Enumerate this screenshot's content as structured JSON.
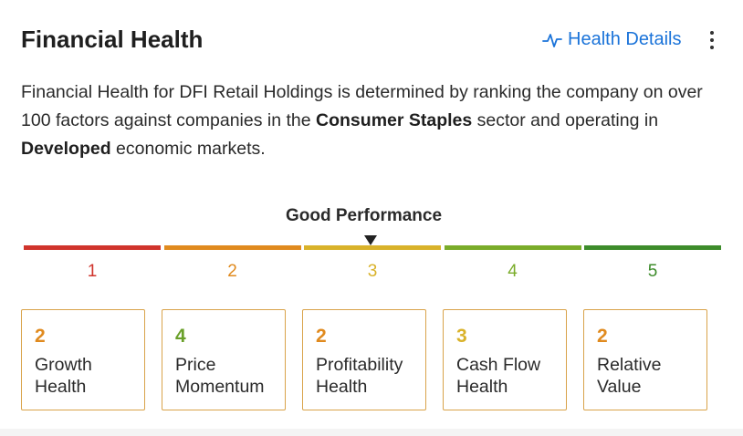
{
  "header": {
    "title": "Financial Health",
    "details_link_label": "Health Details"
  },
  "description": {
    "part1": "Financial Health for DFI Retail Holdings is determined by ranking the company on over 100 factors against companies in the ",
    "sector": "Consumer Staples",
    "part2": " sector and operating in ",
    "market": "Developed",
    "part3": " economic markets."
  },
  "performance": {
    "label": "Good Performance",
    "level": 3
  },
  "scale": {
    "steps": [
      {
        "number": "1",
        "color": "#d0342c"
      },
      {
        "number": "2",
        "color": "#e08a1e"
      },
      {
        "number": "3",
        "color": "#d9b22a"
      },
      {
        "number": "4",
        "color": "#7aac2a"
      },
      {
        "number": "5",
        "color": "#3d8c2b"
      }
    ]
  },
  "cards": [
    {
      "score": "2",
      "label": "Growth\nHealth",
      "color": "#e08a1e"
    },
    {
      "score": "4",
      "label": "Price\nMomentum",
      "color": "#6aa02a"
    },
    {
      "score": "2",
      "label": "Profitability\nHealth",
      "color": "#e08a1e"
    },
    {
      "score": "3",
      "label": "Cash Flow\nHealth",
      "color": "#d9b22a"
    },
    {
      "score": "2",
      "label": "Relative\nValue",
      "color": "#e08a1e"
    }
  ],
  "icons": {
    "details": "activity-pulse-icon",
    "menu": "more-vertical-icon"
  }
}
